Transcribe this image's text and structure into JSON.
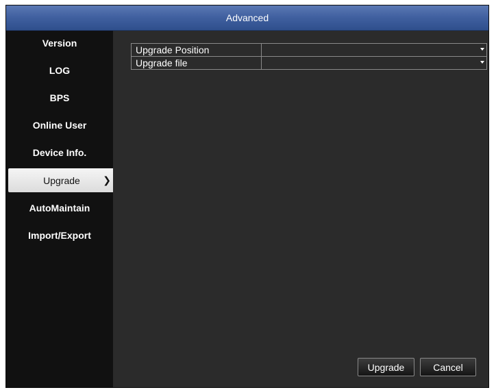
{
  "window": {
    "title": "Advanced"
  },
  "sidebar": {
    "items": [
      {
        "label": "Version"
      },
      {
        "label": "LOG"
      },
      {
        "label": "BPS"
      },
      {
        "label": "Online User"
      },
      {
        "label": "Device Info."
      },
      {
        "label": "Upgrade",
        "active": true
      },
      {
        "label": "AutoMaintain"
      },
      {
        "label": "Import/Export"
      }
    ]
  },
  "settings": {
    "rows": [
      {
        "label": "Upgrade Position",
        "value": ""
      },
      {
        "label": "Upgrade file",
        "value": ""
      }
    ]
  },
  "buttons": {
    "upgrade": "Upgrade",
    "cancel": "Cancel"
  }
}
